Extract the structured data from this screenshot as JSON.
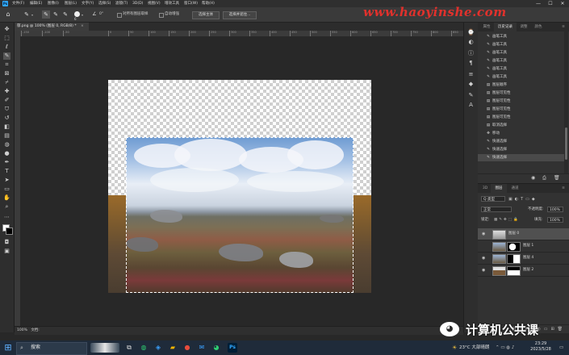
{
  "menubar": {
    "logo": "Ps",
    "items": [
      "文件(F)",
      "编辑(E)",
      "图像(I)",
      "图层(L)",
      "文字(Y)",
      "选择(S)",
      "滤镜(T)",
      "3D(D)",
      "视图(V)",
      "增效工具",
      "窗口(W)",
      "帮助(H)"
    ],
    "minimize": "—",
    "maximize": "☐",
    "close": "✕"
  },
  "options": {
    "brush_size": "6",
    "angle_value": "0°",
    "sample_all_layers": "对所有图层取样",
    "auto_enhance": "自动增强",
    "select_subject": "选择主体",
    "select_and_mask": "选择并遮住..."
  },
  "watermark": "www.haoyinshe.com",
  "document": {
    "tab_title": "郁.png @ 100% (图层 0, RGB/8) *",
    "close": "×"
  },
  "ruler_ticks": [
    "-150",
    "-100",
    "-50",
    "0",
    "50",
    "100",
    "150",
    "200",
    "250",
    "300",
    "350",
    "400",
    "450",
    "500",
    "550",
    "600",
    "650",
    "700",
    "750",
    "800",
    "850"
  ],
  "statusbar": {
    "zoom": "100%",
    "doc_info": "文档:"
  },
  "history": {
    "tabs": [
      "属性",
      "历史记录",
      "调整",
      "颜色"
    ],
    "active_tab": 1,
    "items": [
      {
        "icon": "brush-icon",
        "label": "画笔工具"
      },
      {
        "icon": "brush-icon",
        "label": "画笔工具"
      },
      {
        "icon": "brush-icon",
        "label": "画笔工具"
      },
      {
        "icon": "brush-icon",
        "label": "画笔工具"
      },
      {
        "icon": "brush-icon",
        "label": "画笔工具"
      },
      {
        "icon": "brush-icon",
        "label": "画笔工具"
      },
      {
        "icon": "layer-icon",
        "label": "图层顺序"
      },
      {
        "icon": "layer-icon",
        "label": "图层可见性"
      },
      {
        "icon": "layer-icon",
        "label": "图层可见性"
      },
      {
        "icon": "layer-icon",
        "label": "图层可见性"
      },
      {
        "icon": "layer-icon",
        "label": "图层可见性"
      },
      {
        "icon": "layer-icon",
        "label": "取消选择"
      },
      {
        "icon": "move-icon",
        "label": "移动"
      },
      {
        "icon": "quick-select-icon",
        "label": "快速选择"
      },
      {
        "icon": "quick-select-icon",
        "label": "快速选择"
      },
      {
        "icon": "quick-select-icon",
        "label": "快速选择"
      }
    ]
  },
  "layers": {
    "tabs": [
      "3D",
      "图层",
      "通道"
    ],
    "filter_label": "Q 类型",
    "blend_mode": "正常",
    "opacity_label": "不透明度:",
    "opacity_value": "100%",
    "lock_label": "锁定:",
    "fill_label": "填充:",
    "fill_value": "100%",
    "items": [
      {
        "name": "图层 0",
        "active": true
      },
      {
        "name": "图层 1",
        "active": false
      },
      {
        "name": "图层 4",
        "active": false
      },
      {
        "name": "图层 2",
        "active": false
      }
    ]
  },
  "wechat": {
    "account": "计算机公共课"
  },
  "taskbar": {
    "search_placeholder": "搜索",
    "weather": "23°C 大部晴朗",
    "time": "23:29",
    "date": "2023/5/28"
  }
}
